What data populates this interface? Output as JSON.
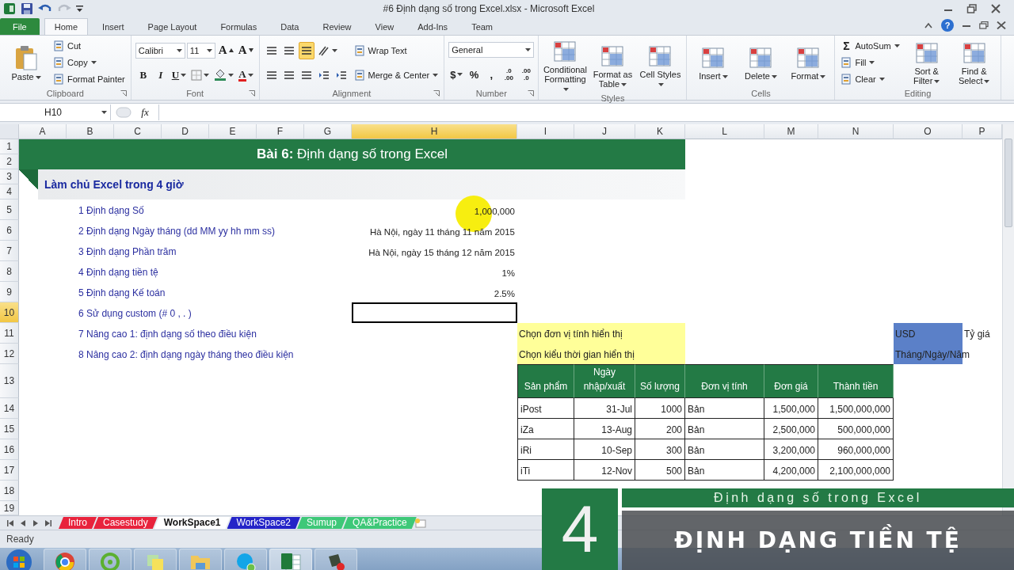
{
  "window": {
    "title": "#6 Định dạng số trong Excel.xlsx - Microsoft Excel",
    "help": "?"
  },
  "ribbon_tabs": [
    {
      "label": "File",
      "kind": "file",
      "selected": false
    },
    {
      "label": "Home",
      "kind": "tab",
      "selected": true
    },
    {
      "label": "Insert",
      "kind": "tab",
      "selected": false
    },
    {
      "label": "Page Layout",
      "kind": "tab",
      "selected": false
    },
    {
      "label": "Formulas",
      "kind": "tab",
      "selected": false
    },
    {
      "label": "Data",
      "kind": "tab",
      "selected": false
    },
    {
      "label": "Review",
      "kind": "tab",
      "selected": false
    },
    {
      "label": "View",
      "kind": "tab",
      "selected": false
    },
    {
      "label": "Add-Ins",
      "kind": "tab",
      "selected": false
    },
    {
      "label": "Team",
      "kind": "tab",
      "selected": false
    }
  ],
  "ribbon_groups": [
    {
      "label": "Clipboard",
      "launcher": true,
      "blocks": [
        [
          [
            {
              "kind": "clipboard",
              "label": "Paste",
              "dropdown": true
            }
          ]
        ],
        [
          [
            {
              "kind": "small",
              "label": "Cut",
              "dropdown": false
            }
          ],
          [
            {
              "kind": "small",
              "label": "Copy",
              "dropdown": true
            }
          ],
          [
            {
              "kind": "small",
              "label": "Format Painter",
              "dropdown": false
            }
          ]
        ]
      ]
    },
    {
      "label": "Font",
      "launcher": true,
      "blocks": [
        [
          [
            {
              "kind": "field",
              "value": "Calibri"
            },
            {
              "kind": "field",
              "value": "11"
            },
            {
              "kind": "grow",
              "label": "A"
            },
            {
              "kind": "shrink",
              "label": "A"
            }
          ],
          [
            {
              "kind": "bold",
              "label": "B",
              "dropdown": false
            },
            {
              "kind": "italic",
              "label": "I",
              "dropdown": false
            },
            {
              "kind": "underline",
              "label": "U",
              "dropdown": true
            },
            {
              "kind": "grid"
            },
            {
              "kind": "bucket"
            },
            {
              "kind": "color-letter",
              "label": "A",
              "color": "#e02020"
            }
          ]
        ]
      ]
    },
    {
      "label": "Alignment",
      "launcher": true,
      "blocks": [
        [
          [
            {
              "kind": "lines",
              "selected": false
            },
            {
              "kind": "lines",
              "selected": false
            },
            {
              "kind": "lines",
              "selected": true
            },
            {
              "kind": "angle"
            }
          ],
          [
            {
              "kind": "lines",
              "selected": false
            },
            {
              "kind": "lines",
              "selected": false
            },
            {
              "kind": "lines",
              "selected": false
            },
            {
              "kind": "indent"
            },
            {
              "kind": "indent"
            }
          ]
        ],
        [
          [
            {
              "kind": "small",
              "label": "Wrap Text",
              "dropdown": false
            }
          ],
          [
            {
              "kind": "small",
              "label": "Merge & Center",
              "dropdown": true
            }
          ]
        ]
      ]
    },
    {
      "label": "Number",
      "launcher": true,
      "blocks": [
        [
          [
            {
              "kind": "field",
              "value": "General"
            }
          ],
          [
            {
              "kind": "symbol",
              "label": "$",
              "dropdown": true
            },
            {
              "kind": "symbol",
              "label": "%",
              "dropdown": false
            },
            {
              "kind": "symbol",
              "label": ",",
              "dropdown": false
            },
            {
              "kind": "stacked",
              "top": ".0",
              "bottom": ".00"
            },
            {
              "kind": "stacked",
              "top": ".00",
              "bottom": ".0"
            }
          ]
        ]
      ]
    },
    {
      "label": "Styles",
      "launcher": false,
      "blocks": [
        [
          [
            {
              "kind": "large",
              "label": "Conditional Formatting",
              "dropdown": true
            }
          ]
        ],
        [
          [
            {
              "kind": "large",
              "label": "Format as Table",
              "dropdown": true
            }
          ]
        ],
        [
          [
            {
              "kind": "large",
              "label": "Cell Styles",
              "dropdown": true
            }
          ]
        ]
      ]
    },
    {
      "label": "Cells",
      "launcher": false,
      "blocks": [
        [
          [
            {
              "kind": "large",
              "label": "Insert",
              "dropdown": true
            }
          ]
        ],
        [
          [
            {
              "kind": "large",
              "label": "Delete",
              "dropdown": true
            }
          ]
        ],
        [
          [
            {
              "kind": "large",
              "label": "Format",
              "dropdown": true
            }
          ]
        ]
      ]
    },
    {
      "label": "Editing",
      "launcher": false,
      "blocks": [
        [
          [
            {
              "kind": "small",
              "symbol": "Σ",
              "label": "AutoSum",
              "dropdown": true
            }
          ],
          [
            {
              "kind": "small",
              "label": "Fill",
              "dropdown": true
            }
          ],
          [
            {
              "kind": "small",
              "label": "Clear",
              "dropdown": true
            }
          ]
        ],
        [
          [
            {
              "kind": "large",
              "label": "Sort & Filter",
              "dropdown": true
            }
          ]
        ],
        [
          [
            {
              "kind": "large",
              "label": "Find & Select",
              "dropdown": true
            }
          ]
        ]
      ]
    }
  ],
  "formula_bar": {
    "name_box": "H10",
    "function_label": "fx"
  },
  "sheet": {
    "columns": [
      "A",
      "B",
      "C",
      "D",
      "E",
      "F",
      "G",
      "H",
      "I",
      "J",
      "K",
      "L",
      "M",
      "N",
      "O",
      "P"
    ],
    "rows": [
      "1",
      "2",
      "3",
      "4",
      "5",
      "6",
      "7",
      "8",
      "9",
      "10",
      "11",
      "12",
      "13",
      "14",
      "15",
      "16",
      "17",
      "18",
      "19"
    ]
  },
  "banner": {
    "title": "**Bài 6:** Định dạng số trong Excel",
    "subtitle": "Làm chủ Excel trong 4 giờ"
  },
  "topics": [
    {
      "label": "1 Định dạng Số",
      "value": "1,000,000",
      "selected": false
    },
    {
      "label": "2 Định dạng Ngày tháng (dd MM yy hh mm ss)",
      "value": "Hà Nội, ngày 11 tháng 11 năm 2015",
      "selected": false
    },
    {
      "label": "3 Định dạng Phần trăm",
      "value": "Hà Nội, ngày 15 tháng 12 năm 2015",
      "selected": false
    },
    {
      "label": "4 Định dạng tiền tệ",
      "value": "1%",
      "selected": false
    },
    {
      "label": "5 Định dạng Kế toán",
      "value": "2.5%",
      "selected": false
    },
    {
      "label": "6 Sử dụng custom (# 0 , . )",
      "selected": true
    },
    {
      "label": "7 Nâng cao 1: định dạng số theo điều kiện",
      "selected": false
    },
    {
      "label": "8 Nâng cao 2: định dạng ngày tháng theo điều kiện",
      "selected": false
    }
  ],
  "options": [
    {
      "label": "Chọn đơn vị tính hiển thị",
      "value": "USD",
      "extra": "Tỷ giá"
    },
    {
      "label": "Chọn kiểu thời gian hiển thị",
      "value": "Tháng/Ngày/Năm"
    }
  ],
  "table": {
    "columns": [
      "Sản phẩm",
      "Ngày nhập/xuất",
      "Số lượng",
      "Đơn vị tính",
      "Đơn giá",
      "Thành tiền"
    ],
    "rows": [
      [
        "iPost",
        "31-Jul",
        "1000",
        "Bản",
        "1,500,000",
        "1,500,000,000"
      ],
      [
        "iZa",
        "13-Aug",
        "200",
        "Bản",
        "2,500,000",
        "500,000,000"
      ],
      [
        "iRi",
        "10-Sep",
        "300",
        "Bản",
        "3,200,000",
        "960,000,000"
      ],
      [
        "iTi",
        "12-Nov",
        "500",
        "Bản",
        "4,200,000",
        "2,100,000,000"
      ]
    ]
  },
  "sheet_tabs": [
    {
      "label": "Intro",
      "color": "#e8233c",
      "selected": false
    },
    {
      "label": "Casestudy",
      "color": "#e8233c",
      "selected": false
    },
    {
      "label": "WorkSpace1",
      "selected": true
    },
    {
      "label": "WorkSpace2",
      "color": "#2424c8",
      "selected": false
    },
    {
      "label": "Sumup",
      "color": "#3ec878",
      "selected": false
    },
    {
      "label": "QA&Practice",
      "color": "#3ec878",
      "selected": false
    }
  ],
  "status_bar": {
    "text": "Ready"
  },
  "taskbar": {
    "apps": [
      {
        "kind": "wheel",
        "active": false
      },
      {
        "kind": "ring",
        "active": false
      },
      {
        "kind": "notes",
        "active": false
      },
      {
        "kind": "folder",
        "active": false
      },
      {
        "kind": "chat",
        "active": false
      },
      {
        "kind": "spreadsheet",
        "active": true
      },
      {
        "kind": "recorder",
        "active": false
      }
    ]
  },
  "video_caption": {
    "number": "4",
    "subtitle": "Định dạng số trong Excel",
    "title": "ĐỊNH DẠNG TIỀN TỆ"
  }
}
